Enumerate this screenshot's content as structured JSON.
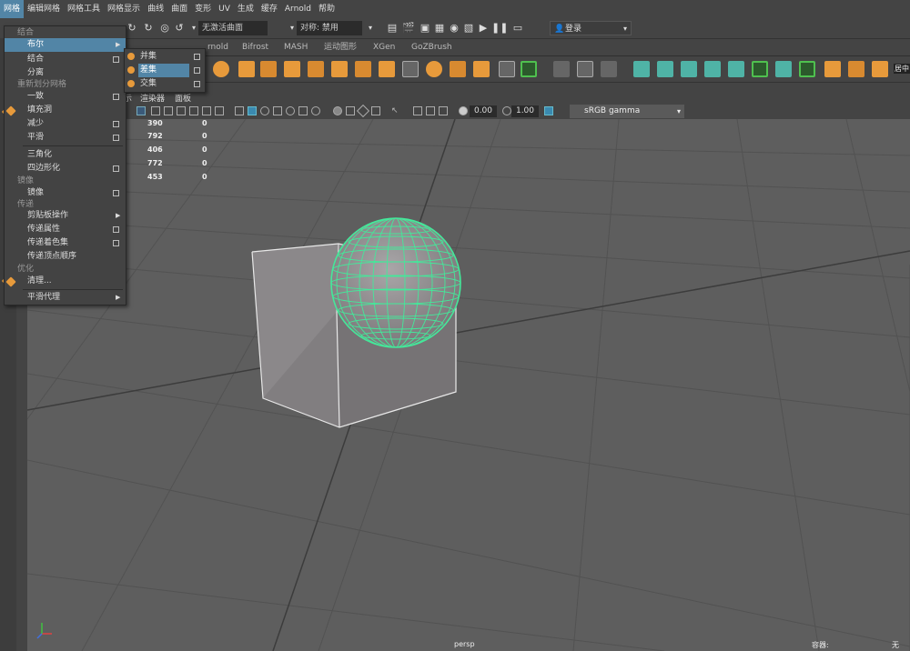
{
  "menubar": [
    "网格",
    "编辑网格",
    "网格工具",
    "网格显示",
    "曲线",
    "曲面",
    "变形",
    "UV",
    "生成",
    "缓存",
    "Arnold",
    "帮助"
  ],
  "statusline": {
    "surface_field": "无激活曲面",
    "symmetry_field": "对称: 禁用",
    "login": "登录"
  },
  "shelf_tabs": [
    "rnold",
    "Bifrost",
    "MASH",
    "运动图形",
    "XGen",
    "GoZBrush"
  ],
  "shelf_right_label": "居中",
  "panel_menu": [
    "示",
    "渲染器",
    "面板"
  ],
  "panel_toolbar": {
    "exposure": "0.00",
    "gamma": "1.00",
    "color_space": "sRGB gamma"
  },
  "hud": {
    "rows": [
      {
        "a": "390",
        "b": "0"
      },
      {
        "a": "792",
        "b": "0"
      },
      {
        "a": "406",
        "b": "0"
      },
      {
        "a": "772",
        "b": "0"
      },
      {
        "a": "453",
        "b": "0"
      }
    ],
    "camera": "persp",
    "capacity_label": "容器:",
    "capacity_value": "无"
  },
  "mesh_menu": {
    "sections": {
      "combine": "结合",
      "remesh": "重新划分网格",
      "mirror": "镜像",
      "transfer": "传递",
      "optimize": "优化"
    },
    "items": {
      "boolean": "布尔",
      "combine": "结合",
      "separate": "分离",
      "conform": "一致",
      "fill_hole": "填充洞",
      "reduce": "减少",
      "smooth": "平滑",
      "triangulate": "三角化",
      "quadrangulate": "四边形化",
      "mirror": "镜像",
      "clipboard": "剪贴板操作",
      "transfer_attributes": "传递属性",
      "transfer_shading": "传递着色集",
      "transfer_vertex_order": "传递顶点顺序",
      "cleanup": "清理...",
      "smooth_proxy": "平滑代理"
    }
  },
  "boolean_submenu": {
    "union": "并集",
    "difference": "差集",
    "intersection": "交集"
  },
  "colors": {
    "highlight": "#5285a6",
    "wire_green": "#44e89a",
    "shelf_orange": "#e79a3b",
    "shelf_teal": "#4fb3a6"
  }
}
